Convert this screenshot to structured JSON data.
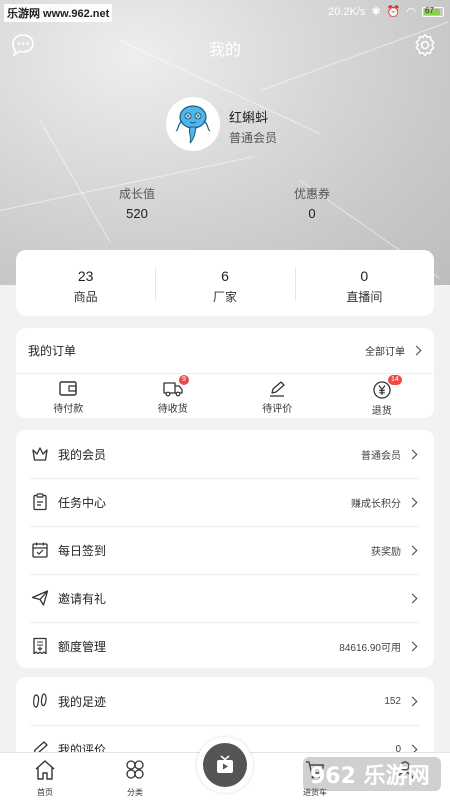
{
  "statusbar": {
    "site": "乐游网 www.962.net",
    "speed": "20.2K/s",
    "battery": "67"
  },
  "header": {
    "title": "我的"
  },
  "user": {
    "name": "红蝌蚪",
    "level": "普通会员"
  },
  "stats": [
    {
      "label": "成长值",
      "value": "520"
    },
    {
      "label": "优惠券",
      "value": "0"
    }
  ],
  "counts": [
    {
      "num": "23",
      "label": "商品"
    },
    {
      "num": "6",
      "label": "厂家"
    },
    {
      "num": "0",
      "label": "直播间"
    }
  ],
  "orders": {
    "title": "我的订单",
    "all_label": "全部订单",
    "items": [
      {
        "label": "待付款",
        "icon": "wallet-icon",
        "badge": ""
      },
      {
        "label": "待收货",
        "icon": "truck-icon",
        "badge": "9"
      },
      {
        "label": "待评价",
        "icon": "pen-icon",
        "badge": ""
      },
      {
        "label": "退货",
        "icon": "yen-icon",
        "badge": "14"
      }
    ]
  },
  "menu": [
    {
      "label": "我的会员",
      "value": "普通会员",
      "icon": "crown-icon"
    },
    {
      "label": "任务中心",
      "value": "赚成长积分",
      "icon": "clipboard-icon"
    },
    {
      "label": "每日签到",
      "value": "获奖励",
      "icon": "calendar-icon"
    },
    {
      "label": "邀请有礼",
      "value": "",
      "icon": "paper-plane-icon"
    },
    {
      "label": "额度管理",
      "value": "84616.90可用",
      "icon": "receipt-icon"
    }
  ],
  "menu2": [
    {
      "label": "我的足迹",
      "value": "152",
      "icon": "footprint-icon"
    },
    {
      "label": "我的评价",
      "value": "0",
      "icon": "pen-icon"
    }
  ],
  "tabs": [
    {
      "label": "首页",
      "icon": "home-icon"
    },
    {
      "label": "分类",
      "icon": "category-icon"
    },
    {
      "label": "",
      "icon": "live-icon"
    },
    {
      "label": "进货车",
      "icon": "cart-icon"
    },
    {
      "label": "",
      "icon": "user-icon"
    }
  ],
  "watermark": "962 乐游网"
}
